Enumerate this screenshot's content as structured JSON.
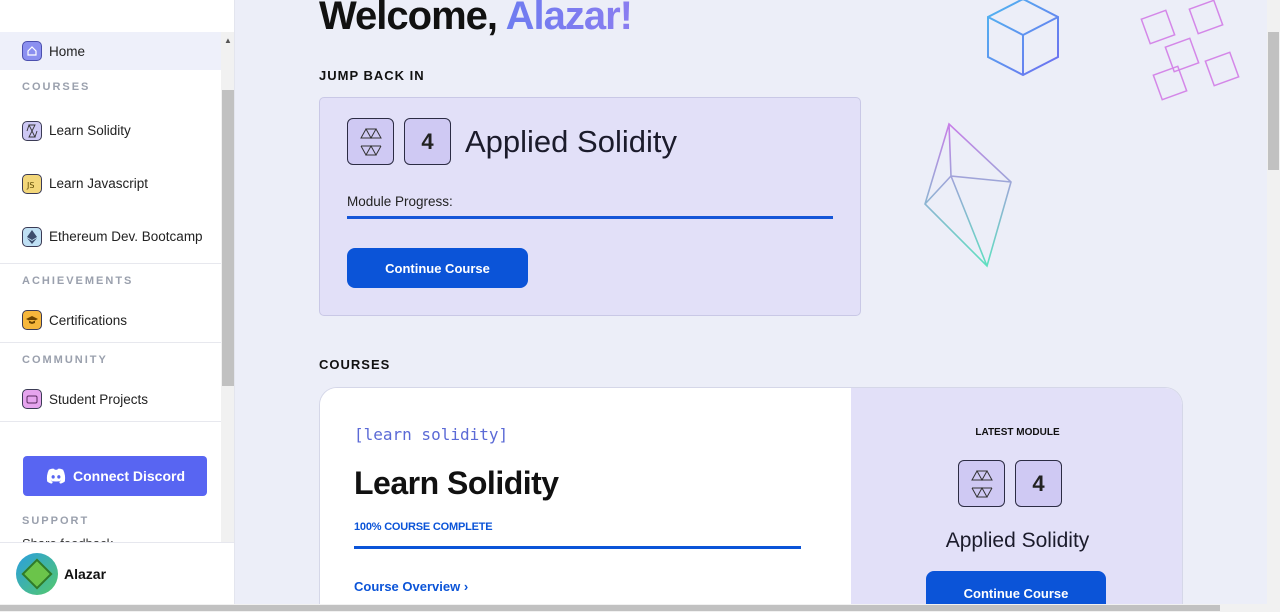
{
  "sidebar": {
    "home_label": "Home",
    "courses_heading": "COURSES",
    "courses": [
      {
        "label": "Learn Solidity",
        "icon": "solidity-icon"
      },
      {
        "label": "Learn Javascript",
        "icon": "javascript-icon"
      },
      {
        "label": "Ethereum Dev. Bootcamp",
        "icon": "ethereum-icon"
      }
    ],
    "achievements_heading": "ACHIEVEMENTS",
    "certifications_label": "Certifications",
    "community_heading": "COMMUNITY",
    "projects_label": "Student Projects",
    "discord_label": "Connect Discord",
    "support_heading": "SUPPORT",
    "support_partial": "Share feedback"
  },
  "user": {
    "name": "Alazar"
  },
  "main": {
    "welcome_prefix": "Welcome, ",
    "welcome_name": "Alazar!",
    "jump_heading": "JUMP BACK IN",
    "jump_card": {
      "module_number": "4",
      "module_title": "Applied Solidity",
      "progress_label": "Module Progress:",
      "progress_fraction": 1.0,
      "button_label": "Continue Course"
    },
    "courses_heading": "COURSES",
    "course_card": {
      "tag": "[learn solidity]",
      "title": "Learn Solidity",
      "complete_label": "100% COURSE COMPLETE",
      "overview_link": "Course Overview",
      "latest_label": "LATEST MODULE",
      "latest_number": "4",
      "latest_title": "Applied Solidity",
      "button_label": "Continue Course"
    }
  },
  "colors": {
    "accent": "#0b54d8",
    "discord": "#5865f2",
    "card_bg": "#e2e0f8",
    "page_bg": "#eceef8"
  }
}
